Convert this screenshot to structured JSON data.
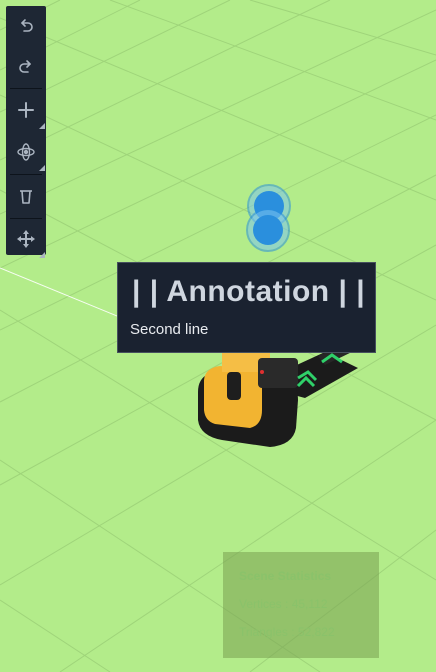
{
  "scene": {
    "ground_color": "#b3ec8a",
    "grid_color": "#9fd47a",
    "marker_color": "#2a8fdd",
    "forklift_body_color": "#f2b431",
    "forklift_dark_color": "#1b1b1b",
    "arrow_color": "#2fd06a"
  },
  "toolbar": {
    "buttons": [
      {
        "name": "undo-button",
        "icon": "undo-icon"
      },
      {
        "name": "redo-button",
        "icon": "redo-icon"
      },
      {
        "name": "add-button",
        "icon": "plus-icon"
      },
      {
        "name": "transform-button",
        "icon": "orbit-icon"
      },
      {
        "name": "delete-button",
        "icon": "trash-icon"
      },
      {
        "name": "move-button",
        "icon": "move-arrows-icon"
      }
    ]
  },
  "annotation": {
    "title": "| | Annotation | |",
    "subtitle": "Second line"
  },
  "stats": {
    "title": "Scene Statistics",
    "vertices": "Vertices : 45,112",
    "triangles": "Triangles : 52,822"
  }
}
